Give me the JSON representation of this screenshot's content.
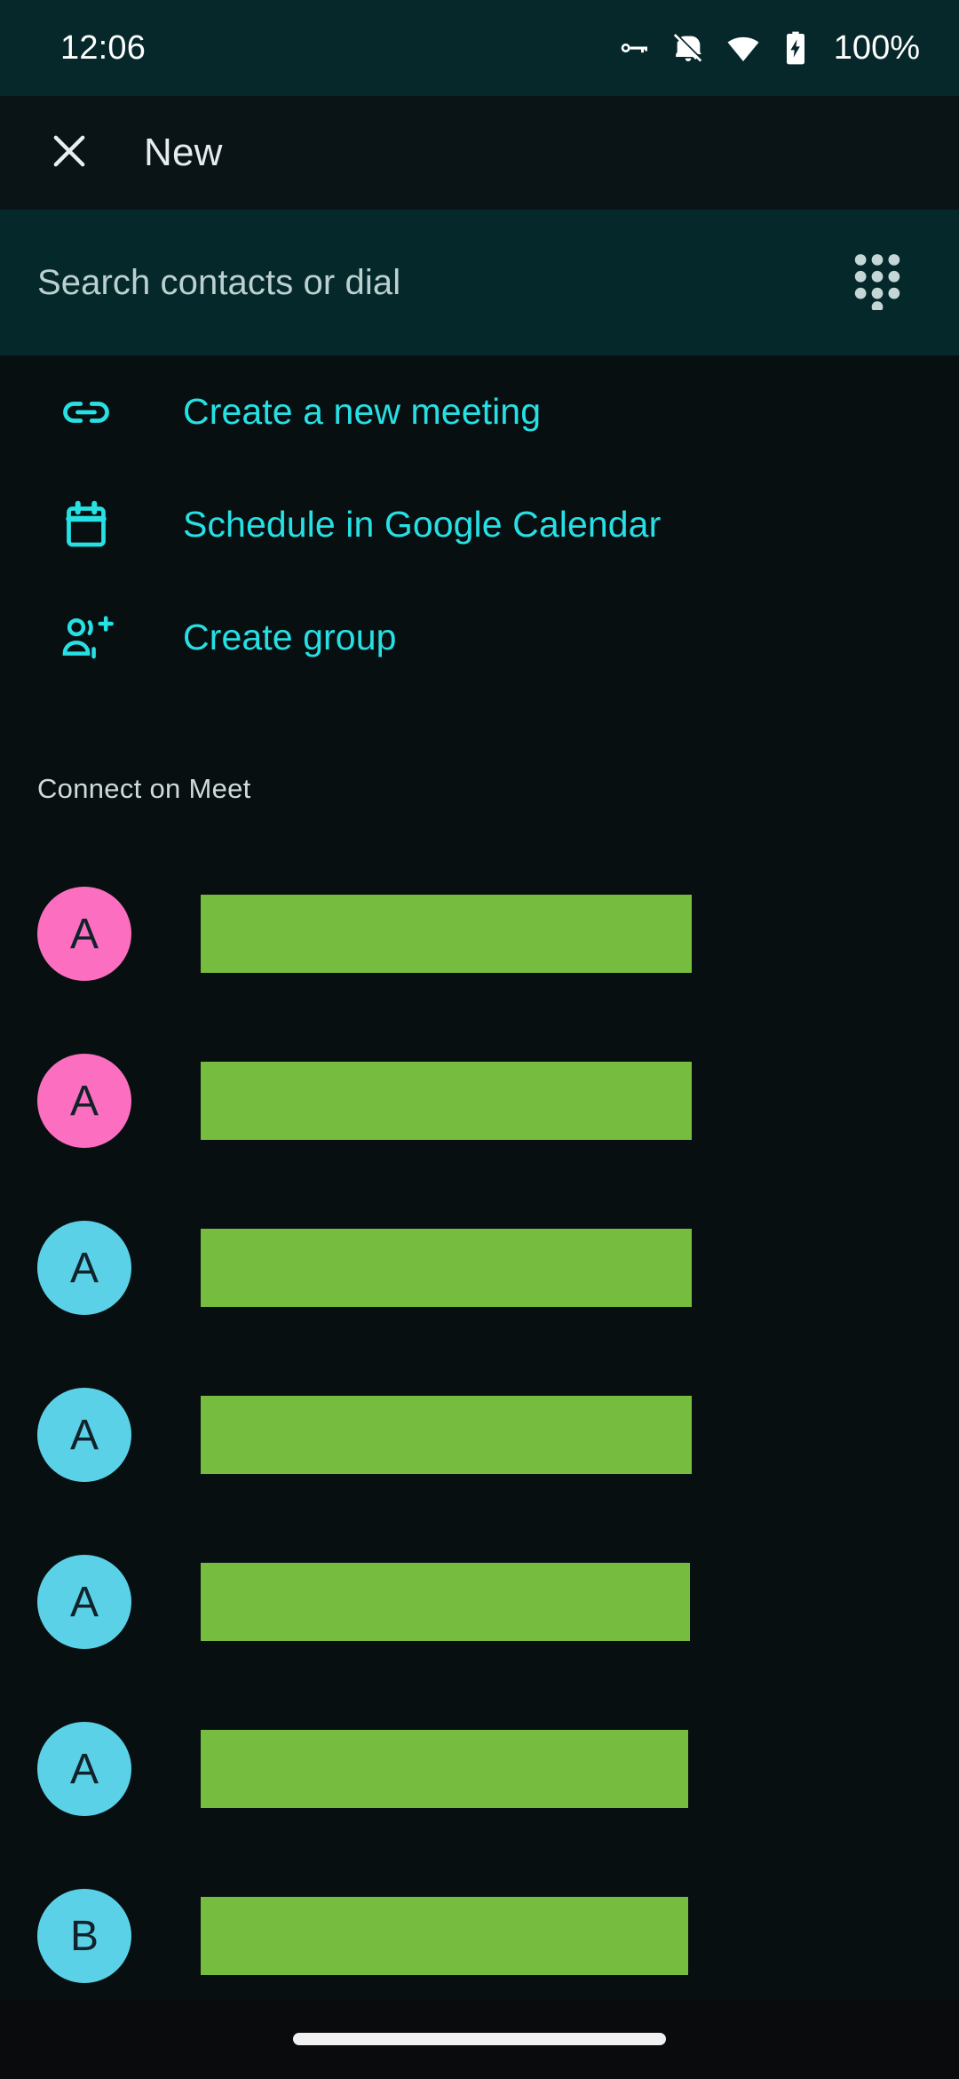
{
  "status_bar": {
    "time": "12:06",
    "battery_text": "100%",
    "icons": [
      "vpn-key-icon",
      "notifications-off-icon",
      "wifi-icon",
      "battery-charging-icon"
    ],
    "background_color": "#06282b"
  },
  "app_bar": {
    "close_icon": "close-icon",
    "title": "New",
    "background_color": "#0a1417"
  },
  "search": {
    "placeholder": "Search contacts or dial",
    "value": "",
    "dialpad_icon": "dialpad-icon",
    "background_color": "#05282b"
  },
  "actions": {
    "accent_color": "#26e0e4",
    "items": [
      {
        "icon": "link-icon",
        "label": "Create a new meeting"
      },
      {
        "icon": "calendar-icon",
        "label": "Schedule in Google Calendar"
      },
      {
        "icon": "group-add-icon",
        "label": "Create group"
      }
    ]
  },
  "contacts_section": {
    "header": "Connect on Meet",
    "redaction_color": "#76bc3e",
    "avatar_pink": "#fb6ec0",
    "avatar_cyan": "#5bd1e8",
    "items": [
      {
        "initial": "A",
        "avatar_color": "pink",
        "name_width": 553
      },
      {
        "initial": "A",
        "avatar_color": "pink",
        "name_width": 553
      },
      {
        "initial": "A",
        "avatar_color": "cyan",
        "name_width": 553
      },
      {
        "initial": "A",
        "avatar_color": "cyan",
        "name_width": 553
      },
      {
        "initial": "A",
        "avatar_color": "cyan",
        "name_width": 551
      },
      {
        "initial": "A",
        "avatar_color": "cyan",
        "name_width": 549
      },
      {
        "initial": "B",
        "avatar_color": "cyan",
        "name_width": 549
      }
    ]
  },
  "nav_bar": {
    "pill": "home-gesture-pill"
  }
}
